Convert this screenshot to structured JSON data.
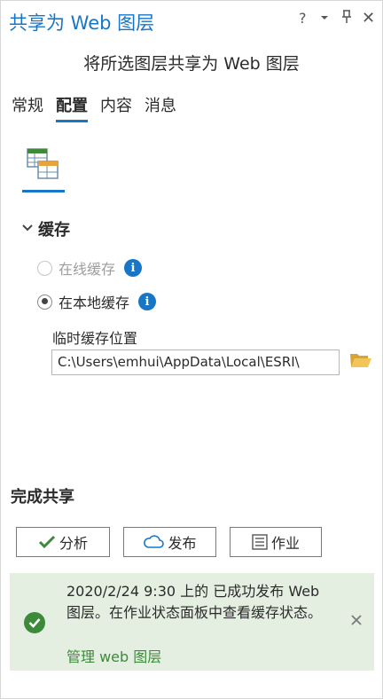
{
  "window": {
    "title": "共享为 Web 图层",
    "help": "?",
    "menu": "▾",
    "pin": "📌",
    "close": "✕"
  },
  "subtitle": "将所选图层共享为 Web 图层",
  "tabs": [
    {
      "label": "常规",
      "active": false
    },
    {
      "label": "配置",
      "active": true
    },
    {
      "label": "内容",
      "active": false
    },
    {
      "label": "消息",
      "active": false
    }
  ],
  "cache": {
    "section_title": "缓存",
    "options": [
      {
        "label": "在线缓存",
        "checked": false,
        "disabled": true
      },
      {
        "label": "在本地缓存",
        "checked": true,
        "disabled": false
      }
    ],
    "location_label": "临时缓存位置",
    "location_value": "C:\\Users\\emhui\\AppData\\Local\\ESRI\\"
  },
  "finish": {
    "title": "完成共享",
    "analyze_label": "分析",
    "publish_label": "发布",
    "job_label": "作业"
  },
  "message": {
    "text": "2020/2/24 9:30 上的 已成功发布 Web 图层。在作业状态面板中查看缓存状态。",
    "link": "管理 web 图层"
  },
  "colors": {
    "accent": "#1976c6",
    "success": "#3c8a3a",
    "message_bg": "#e4efe2"
  }
}
